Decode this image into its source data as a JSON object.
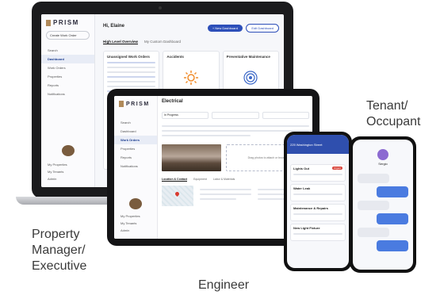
{
  "roles": {
    "tenant_line1": "Tenant/",
    "tenant_line2": "Occupant",
    "pm_line1": "Property",
    "pm_line2": "Manager/",
    "pm_line3": "Executive",
    "engineer": "Engineer"
  },
  "laptop": {
    "logo": "PRISM",
    "greeting": "Hi, Elaine",
    "create_button": "Create Work Order",
    "nav": [
      "Search",
      "Dashboard",
      "Work Orders",
      "Properties",
      "Reports",
      "Notifications"
    ],
    "footer_nav": [
      "My Properties",
      "My Tenants",
      "Admin"
    ],
    "new_dashboard_button": "+ New Dashboard",
    "edit_dashboard_button": "Edit Dashboard",
    "tabs": [
      "High Level Overview",
      "My Custom Dashboard"
    ],
    "cards": [
      "Unassigned Work Orders",
      "Accidents",
      "Preventative Maintenance"
    ]
  },
  "tablet": {
    "logo": "PRISM",
    "title": "Electrical",
    "status_label": "In Progress",
    "nav": [
      "Search",
      "Dashboard",
      "Work Orders",
      "Properties",
      "Reports",
      "Notifications"
    ],
    "footer_nav": [
      "My Properties",
      "My Tenants",
      "Admin"
    ],
    "drop_text": "Drag photos to attach or browse",
    "tabs": [
      "Location & Contact",
      "Equipment",
      "Labor & Materials"
    ]
  },
  "phone1": {
    "header": "225 Washington Street",
    "items": [
      {
        "title": "Lights Out",
        "badge": "Urgent"
      },
      {
        "title": "Water Leak",
        "badge": ""
      },
      {
        "title": "Maintenance & Repairs",
        "badge": ""
      },
      {
        "title": "New Light Fixture",
        "badge": ""
      }
    ]
  },
  "phone2": {
    "contact_name": "Sergio"
  },
  "colors": {
    "brand_blue": "#2d4fb9",
    "urgent_red": "#d9453b",
    "logo_gold": "#b08a5a"
  }
}
